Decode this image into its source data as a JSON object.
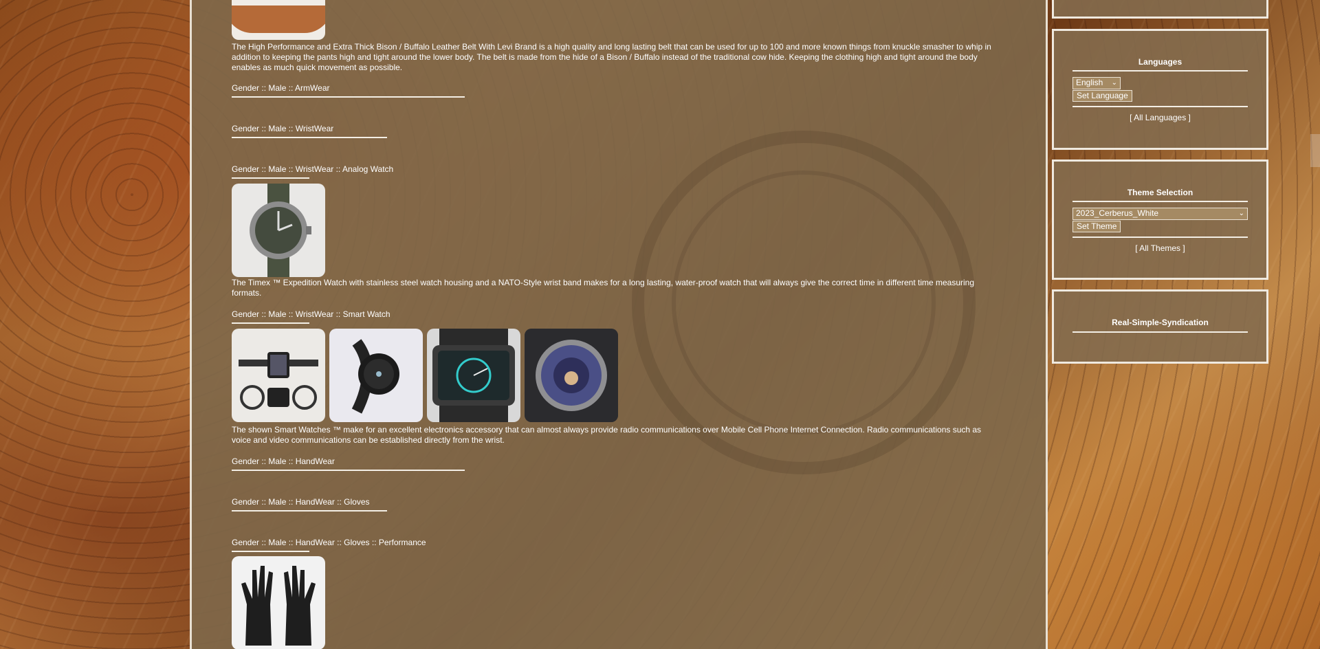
{
  "main": {
    "items": [
      {
        "kind": "desc",
        "text": "The High Performance and Extra Thick Bison / Buffalo Leather Belt With Levi Brand is a high quality and long lasting belt that can be used for up to 100 and more known things from knuckle smasher to whip in addition to keeping the pants high and tight around the lower body. The belt is made from the hide of a Bison / Buffalo instead of the traditional cow hide. Keeping the clothing high and tight around the body enables as much quick movement as possible."
      },
      {
        "kind": "cat",
        "text": "Gender :: Male :: ArmWear"
      },
      {
        "kind": "cat",
        "text": "Gender :: Male :: WristWear"
      },
      {
        "kind": "cat",
        "text": "Gender :: Male :: WristWear :: Analog Watch"
      },
      {
        "kind": "desc",
        "text": "The Timex ™ Expedition Watch with stainless steel watch housing and a NATO-Style wrist band makes for a long lasting, water-proof watch that will always give the correct time in different time measuring formats."
      },
      {
        "kind": "cat",
        "text": "Gender :: Male :: WristWear :: Smart Watch"
      },
      {
        "kind": "desc",
        "text": "The shown Smart Watches ™ make for an excellent electronics accessory that can almost always provide radio communications over Mobile Cell Phone Internet Connection. Radio communications such as voice and video communications can be established directly from the wrist."
      },
      {
        "kind": "cat",
        "text": "Gender :: Male :: HandWear"
      },
      {
        "kind": "cat",
        "text": "Gender :: Male :: HandWear :: Gloves"
      },
      {
        "kind": "cat",
        "text": "Gender :: Male :: HandWear :: Gloves :: Performance"
      }
    ]
  },
  "sidebar": {
    "languages": {
      "title": "Languages",
      "selected": "English",
      "button": "Set Language",
      "link": "[ All Languages ]"
    },
    "theme": {
      "title": "Theme Selection",
      "selected": "2023_Cerberus_White",
      "button": "Set Theme",
      "link": "[ All Themes ]"
    },
    "rss": {
      "title": "Real-Simple-Syndication"
    }
  },
  "icons": {
    "dropdown": "chevron-down-icon"
  }
}
